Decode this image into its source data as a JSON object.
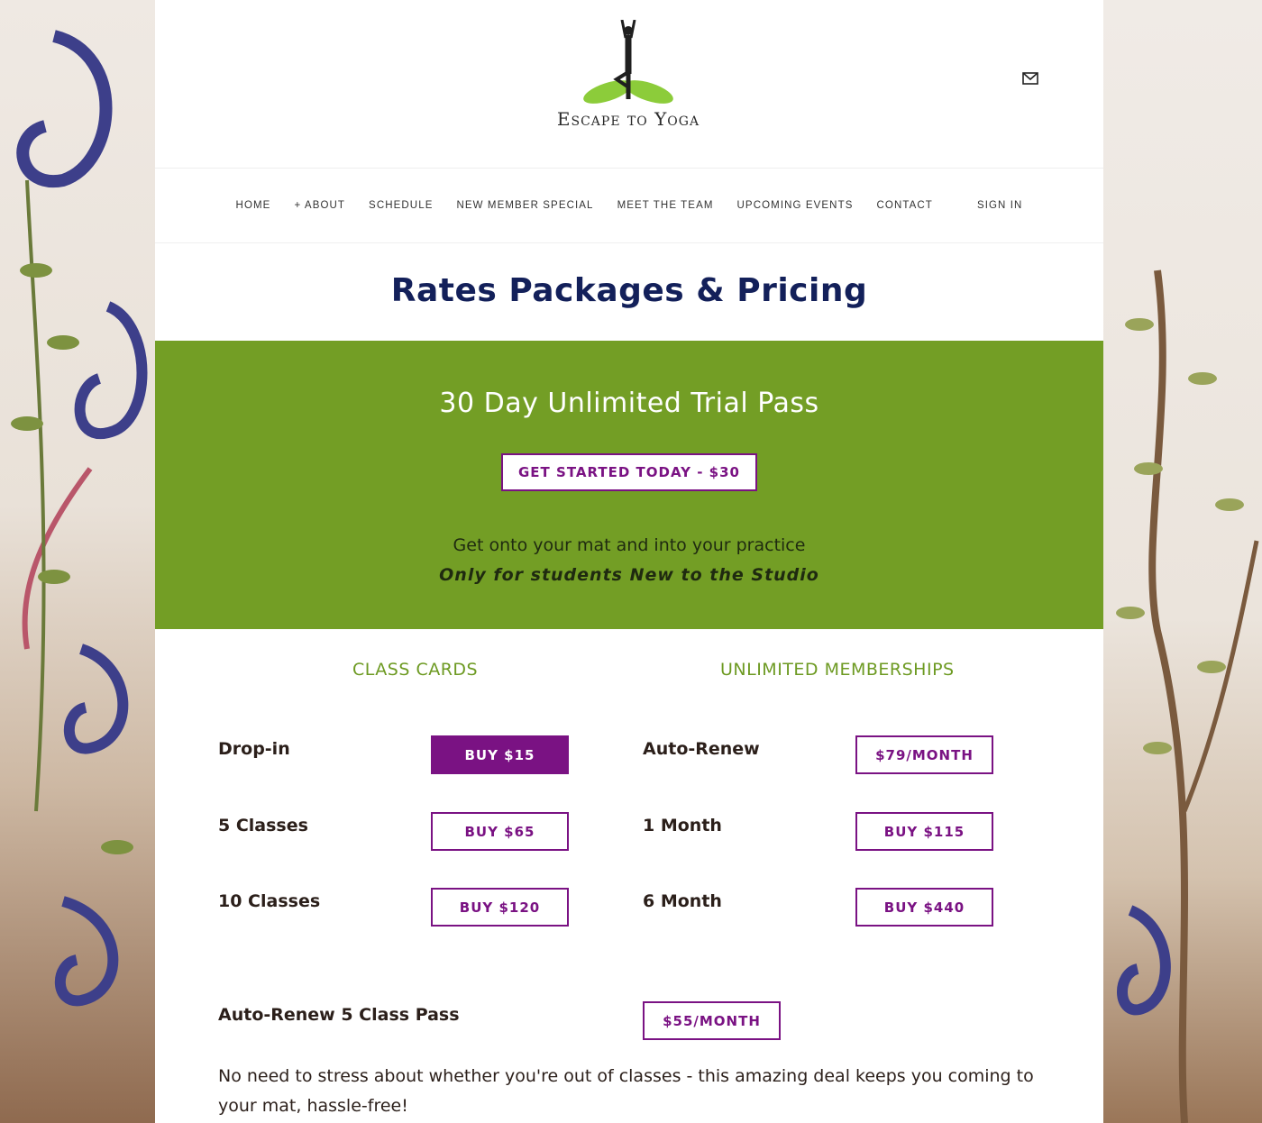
{
  "brand": {
    "name": "Escape to Yoga"
  },
  "nav": {
    "items": [
      "HOME",
      "+ ABOUT",
      "SCHEDULE",
      "NEW MEMBER SPECIAL",
      "MEET THE TEAM",
      "UPCOMING EVENTS",
      "CONTACT"
    ],
    "signin": "SIGN IN"
  },
  "page_title": "Rates Packages & Pricing",
  "promo": {
    "title": "30 Day Unlimited Trial Pass",
    "button": "GET STARTED TODAY - $30",
    "line1": "Get onto your mat and into your practice",
    "line2": "Only for students New to the Studio"
  },
  "class_cards": {
    "heading": "CLASS CARDS",
    "rows": [
      {
        "label": "Drop-in",
        "button": "BUY $15"
      },
      {
        "label": "5 Classes",
        "button": "BUY $65"
      },
      {
        "label": "10 Classes",
        "button": "BUY $120"
      }
    ]
  },
  "memberships": {
    "heading": "UNLIMITED MEMBERSHIPS",
    "rows": [
      {
        "label": "Auto-Renew",
        "button": "$79/MONTH"
      },
      {
        "label": "1 Month",
        "button": "BUY $115"
      },
      {
        "label": "6 Month",
        "button": "BUY $440"
      }
    ]
  },
  "auto_renew_pass": {
    "label": "Auto-Renew 5 Class Pass",
    "button": "$55/MONTH",
    "description": "No need to stress about whether you're out of classes - this amazing deal keeps you coming to your mat, hassle-free!"
  },
  "colors": {
    "accent_purple": "#7a1283",
    "promo_green": "#739e25",
    "heading_green": "#6d9a22",
    "title_navy": "#13205a"
  },
  "icons": {
    "header_right": "mail-icon",
    "logo": "yoga-tree-pose-logo-icon"
  }
}
